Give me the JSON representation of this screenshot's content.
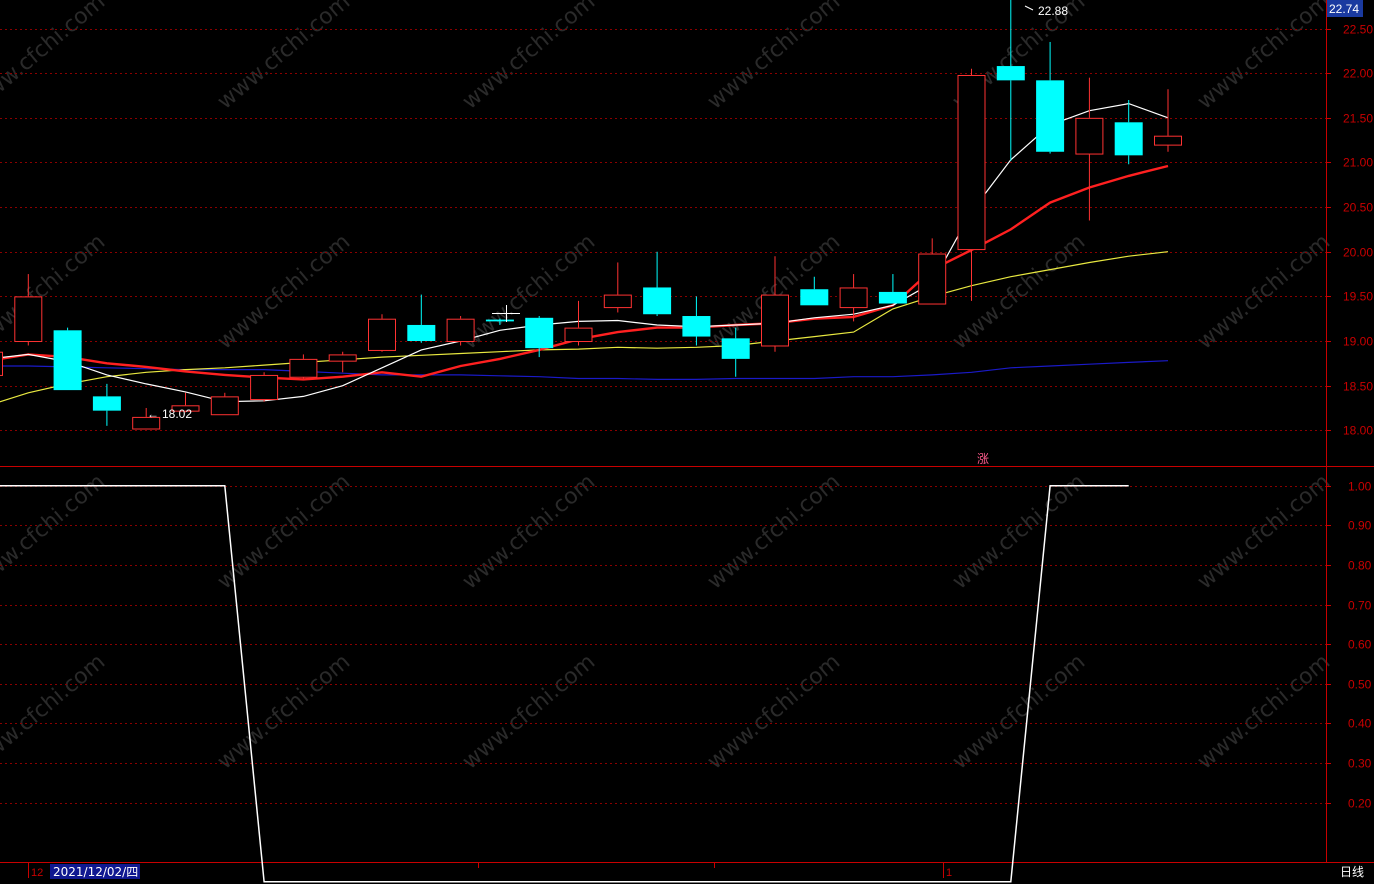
{
  "colors": {
    "background": "#000000",
    "grid": "#8a0000",
    "axis_text": "#c80000",
    "up": "#ff3232",
    "down": "#00ffff",
    "ma1": "#ffffff",
    "ma2": "#ff2020",
    "ma3": "#e8e840",
    "ma4": "#1a1ac8",
    "indicator": "#ffffff",
    "price_box": "#1a3aa0",
    "date_box": "#101890"
  },
  "header": {
    "current_price": "22.74"
  },
  "price_panel": {
    "y_ticks": [
      "22.50",
      "22.00",
      "21.50",
      "21.00",
      "20.50",
      "20.00",
      "19.50",
      "19.00",
      "18.50",
      "18.00"
    ],
    "high_label": "22.88",
    "low_label": "18.02",
    "flag_glyph": "涨"
  },
  "indicator_panel": {
    "y_ticks": [
      "1.00",
      "0.90",
      "0.80",
      "0.70",
      "0.60",
      "0.50",
      "0.40",
      "0.30",
      "0.20"
    ]
  },
  "footer": {
    "month_start": "12",
    "selected_date": "2021/12/02/四",
    "month_next": "1",
    "period_label": "日线"
  },
  "watermark": "www.cfchi.com",
  "chart_data": {
    "type": "candlestick",
    "price_ylim": [
      17.6,
      22.82
    ],
    "indicator_ylim": [
      0.05,
      1.04
    ],
    "candles": [
      {
        "o": 18.62,
        "h": 18.95,
        "l": 18.55,
        "c": 18.88
      },
      {
        "o": 19.0,
        "h": 19.75,
        "l": 18.95,
        "c": 19.5
      },
      {
        "o": 19.12,
        "h": 19.15,
        "l": 18.45,
        "c": 18.45
      },
      {
        "o": 18.38,
        "h": 18.52,
        "l": 18.05,
        "c": 18.22
      },
      {
        "o": 18.02,
        "h": 18.25,
        "l": 18.02,
        "c": 18.15
      },
      {
        "o": 18.22,
        "h": 18.42,
        "l": 18.2,
        "c": 18.28
      },
      {
        "o": 18.18,
        "h": 18.42,
        "l": 18.18,
        "c": 18.38
      },
      {
        "o": 18.35,
        "h": 18.65,
        "l": 18.32,
        "c": 18.62
      },
      {
        "o": 18.6,
        "h": 18.85,
        "l": 18.58,
        "c": 18.8
      },
      {
        "o": 18.78,
        "h": 18.88,
        "l": 18.65,
        "c": 18.85
      },
      {
        "o": 18.9,
        "h": 19.3,
        "l": 18.88,
        "c": 19.25
      },
      {
        "o": 19.18,
        "h": 19.52,
        "l": 18.98,
        "c": 19.0
      },
      {
        "o": 19.0,
        "h": 19.28,
        "l": 18.95,
        "c": 19.25
      },
      {
        "o": 19.24,
        "h": 19.25,
        "l": 19.18,
        "c": 19.22
      },
      {
        "o": 19.26,
        "h": 19.28,
        "l": 18.82,
        "c": 18.92
      },
      {
        "o": 19.0,
        "h": 19.45,
        "l": 18.95,
        "c": 19.15
      },
      {
        "o": 19.38,
        "h": 19.88,
        "l": 19.32,
        "c": 19.52
      },
      {
        "o": 19.6,
        "h": 20.0,
        "l": 19.28,
        "c": 19.3
      },
      {
        "o": 19.28,
        "h": 19.5,
        "l": 18.95,
        "c": 19.05
      },
      {
        "o": 19.03,
        "h": 19.15,
        "l": 18.6,
        "c": 18.8
      },
      {
        "o": 18.95,
        "h": 19.95,
        "l": 18.88,
        "c": 19.52
      },
      {
        "o": 19.58,
        "h": 19.72,
        "l": 19.4,
        "c": 19.4
      },
      {
        "o": 19.38,
        "h": 19.75,
        "l": 19.22,
        "c": 19.6
      },
      {
        "o": 19.55,
        "h": 19.75,
        "l": 19.42,
        "c": 19.42
      },
      {
        "o": 19.42,
        "h": 20.15,
        "l": 19.42,
        "c": 19.98
      },
      {
        "o": 20.03,
        "h": 22.05,
        "l": 19.45,
        "c": 21.98
      },
      {
        "o": 22.08,
        "h": 22.88,
        "l": 21.02,
        "c": 21.92
      },
      {
        "o": 21.92,
        "h": 22.35,
        "l": 21.1,
        "c": 21.12
      },
      {
        "o": 21.1,
        "h": 21.95,
        "l": 20.35,
        "c": 21.5
      },
      {
        "o": 21.45,
        "h": 21.7,
        "l": 20.98,
        "c": 21.08
      },
      {
        "o": 21.2,
        "h": 21.82,
        "l": 21.12,
        "c": 21.3
      }
    ],
    "ma_series": [
      {
        "values": [
          18.8,
          18.85,
          18.77,
          18.62,
          18.52,
          18.43,
          18.32,
          18.33,
          18.38,
          18.5,
          18.7,
          18.9,
          19.0,
          19.12,
          19.18,
          19.22,
          19.23,
          19.18,
          19.16,
          19.18,
          19.2,
          19.26,
          19.3,
          19.4,
          19.65,
          20.45,
          21.03,
          21.42,
          21.58,
          21.66,
          21.5
        ]
      },
      {
        "values": [
          18.78,
          18.85,
          18.82,
          18.75,
          18.71,
          18.66,
          18.62,
          18.59,
          18.57,
          18.6,
          18.65,
          18.6,
          18.72,
          18.8,
          18.9,
          19.02,
          19.1,
          19.15,
          19.15,
          19.18,
          19.2,
          19.25,
          19.27,
          19.4,
          19.8,
          20.02,
          20.25,
          20.55,
          20.72,
          20.85,
          20.96
        ]
      },
      {
        "values": [
          18.28,
          18.42,
          18.52,
          18.6,
          18.65,
          18.68,
          18.7,
          18.73,
          18.76,
          18.79,
          18.82,
          18.84,
          18.86,
          18.88,
          18.9,
          18.91,
          18.93,
          18.92,
          18.93,
          18.95,
          19.0,
          19.05,
          19.1,
          19.36,
          19.5,
          19.62,
          19.72,
          19.8,
          19.88,
          19.95,
          20.0
        ]
      },
      {
        "values": [
          18.72,
          18.72,
          18.71,
          18.7,
          18.69,
          18.68,
          18.68,
          18.68,
          18.66,
          18.64,
          18.62,
          18.62,
          18.62,
          18.61,
          18.6,
          18.58,
          18.58,
          18.57,
          18.57,
          18.58,
          18.58,
          18.58,
          18.6,
          18.6,
          18.62,
          18.65,
          18.7,
          18.72,
          18.74,
          18.76,
          18.78
        ]
      }
    ],
    "indicator_values": [
      1.0,
      1.0,
      1.0,
      1.0,
      1.0,
      1.0,
      1.0,
      0.0,
      0.0,
      0.0,
      0.0,
      0.0,
      0.0,
      0.0,
      0.0,
      0.0,
      0.0,
      0.0,
      0.0,
      0.0,
      0.0,
      0.0,
      0.0,
      0.0,
      0.0,
      0.0,
      0.0,
      1.0,
      1.0,
      1.0
    ]
  }
}
